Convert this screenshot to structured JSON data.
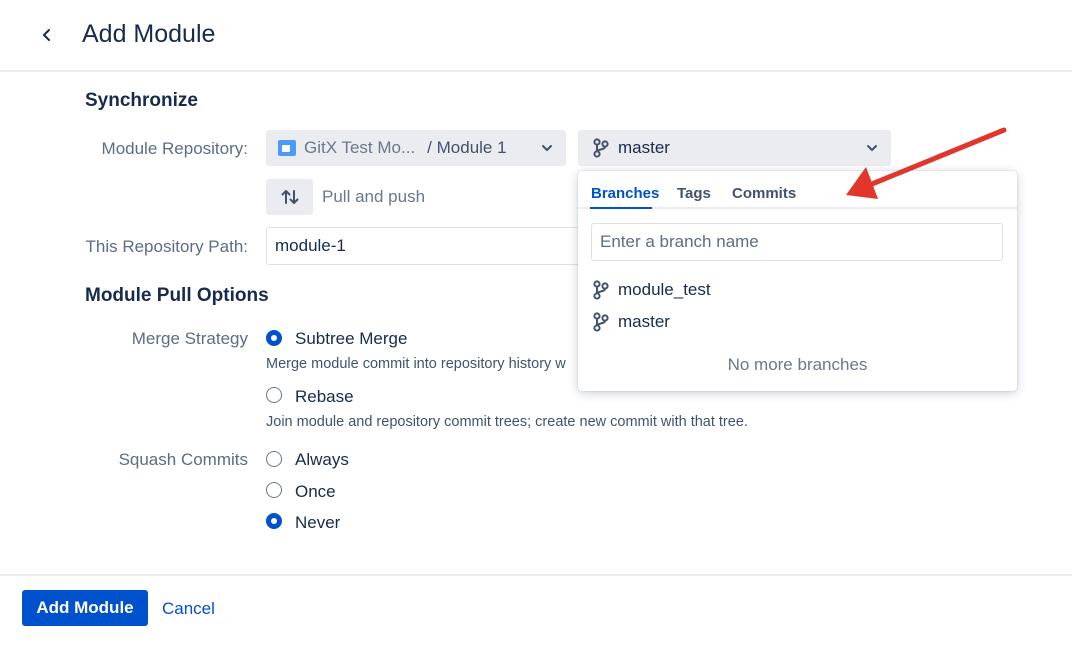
{
  "header": {
    "title": "Add Module"
  },
  "sections": {
    "synchronize": "Synchronize",
    "pull_options": "Module Pull Options"
  },
  "labels": {
    "module_repository": "Module Repository:",
    "repository_path": "This Repository Path:",
    "merge_strategy": "Merge Strategy",
    "squash_commits": "Squash Commits"
  },
  "repo_select": {
    "repo": "GitX Test Mo...",
    "module": "/ Module 1"
  },
  "branch_select": {
    "value": "master"
  },
  "sync_direction": {
    "label": "Pull and push"
  },
  "path_input": {
    "value": "module-1"
  },
  "merge_strategy": {
    "options": [
      {
        "label": "Subtree Merge",
        "hint": "Merge module commit into repository history w",
        "checked": true
      },
      {
        "label": "Rebase",
        "hint": "Join module and repository commit trees; create new commit with that tree.",
        "checked": false
      }
    ]
  },
  "squash_commits": {
    "options": [
      {
        "label": "Always",
        "checked": false
      },
      {
        "label": "Once",
        "checked": false
      },
      {
        "label": "Never",
        "checked": true
      }
    ]
  },
  "dropdown": {
    "tabs": [
      {
        "label": "Branches",
        "active": true
      },
      {
        "label": "Tags",
        "active": false
      },
      {
        "label": "Commits",
        "active": false
      }
    ],
    "search_placeholder": "Enter a branch name",
    "branches": [
      "module_test",
      "master"
    ],
    "empty_text": "No more branches"
  },
  "footer": {
    "submit_label": "Add Module",
    "cancel_label": "Cancel"
  },
  "colors": {
    "primary": "#0052cc",
    "annotation_arrow": "#e0362b",
    "field_bg": "#ebecf0"
  },
  "icons": {
    "back": "chevron-left-icon",
    "folder": "folder-icon",
    "caret": "chevron-down-icon",
    "branch": "git-branch-icon",
    "sync": "pull-push-arrows-icon"
  }
}
